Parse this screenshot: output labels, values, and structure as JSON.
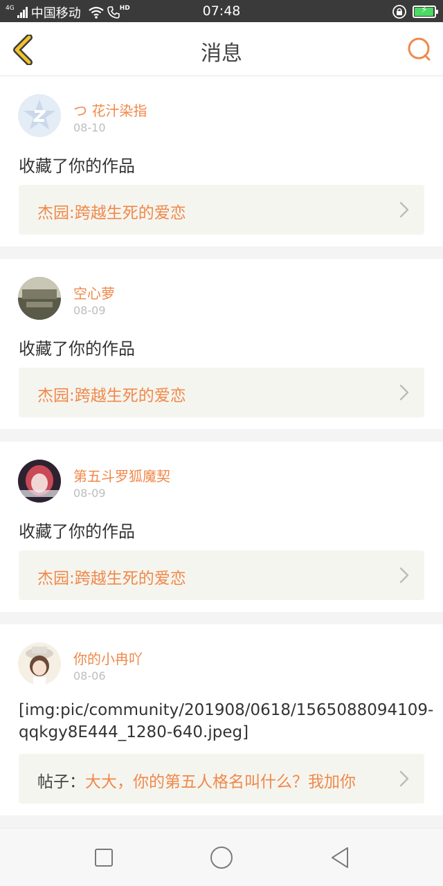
{
  "status_bar": {
    "network_type": "4G",
    "carrier": "中国移动",
    "hd_label": "HD",
    "time": "07:48",
    "battery_percent": 90
  },
  "header": {
    "title": "消息",
    "back_icon": "chevron-left-icon",
    "search_icon": "search-icon"
  },
  "messages": [
    {
      "username": "つ 花汁染指",
      "date": "08-10",
      "action": "收藏了你的作品",
      "link_prefix": "",
      "link_text": "杰园:跨越生死的爱恋"
    },
    {
      "username": "空心萝",
      "date": "08-09",
      "action": "收藏了你的作品",
      "link_prefix": "",
      "link_text": "杰园:跨越生死的爱恋"
    },
    {
      "username": "第五斗罗狐魔契",
      "date": "08-09",
      "action": "收藏了你的作品",
      "link_prefix": "",
      "link_text": "杰园:跨越生死的爱恋"
    },
    {
      "username": "你的小冉吖",
      "date": "08-06",
      "action": "[img:pic/community/201908/0618/1565088094109-qqkgy8E444_1280-640.jpeg]",
      "link_prefix": "帖子：",
      "link_text": "大大，你的第五人格名叫什么？我加你"
    }
  ],
  "colors": {
    "accent": "#f0884a",
    "back_icon": "#f2c12e",
    "link_bg": "#f5f5ef"
  }
}
